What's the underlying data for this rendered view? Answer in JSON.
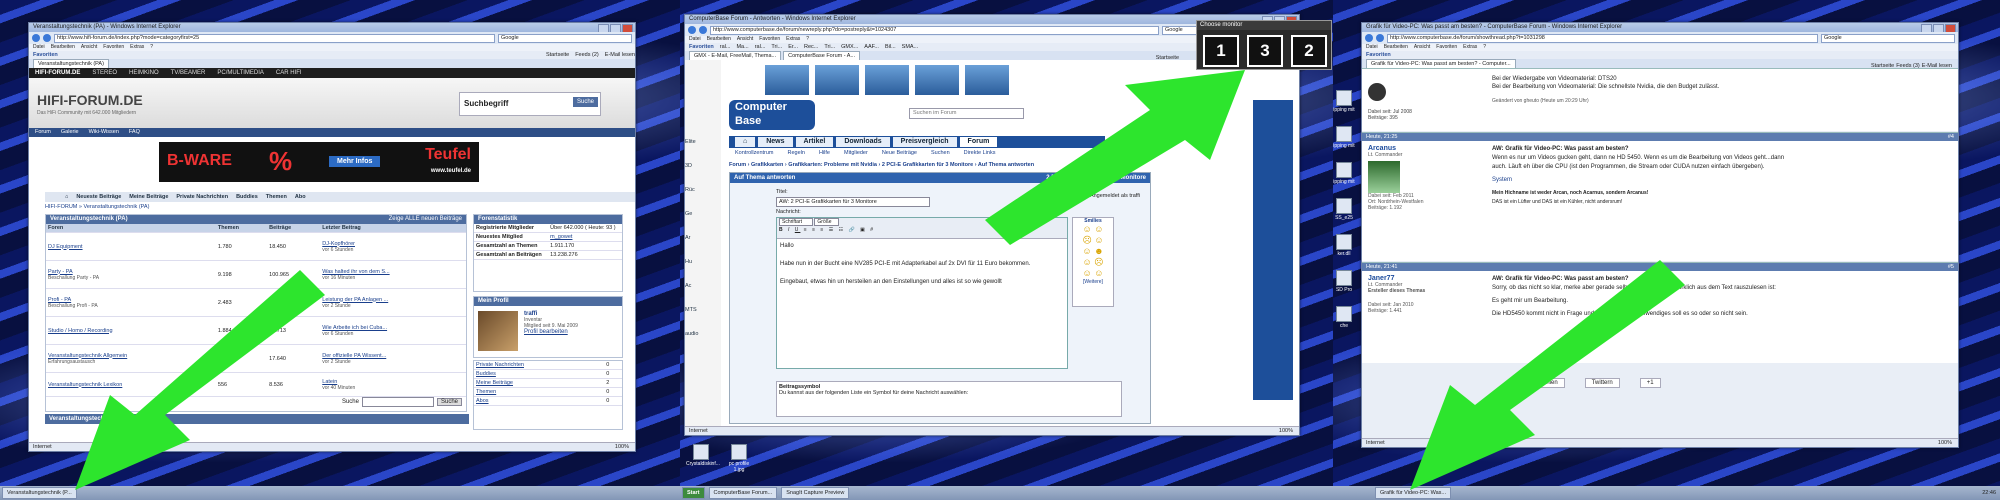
{
  "monitor1": {
    "window_title": "Veranstaltungstechnik (PA) - Windows Internet Explorer",
    "url": "http://www.hifi-forum.de/index.php?mode=categoryfirst=25",
    "search_engine": "Google",
    "menu": [
      "Datei",
      "Bearbeiten",
      "Ansicht",
      "Favoriten",
      "Extras",
      "?"
    ],
    "favorites_label": "Favoriten",
    "fav_items": [
      "Startseite",
      "Feeds (2)",
      "E-Mail lesen"
    ],
    "tab": "Veranstaltungstechnik (PA)",
    "site_top": [
      "HIFI-FORUM.DE",
      "STEREO",
      "HEIMKINO",
      "TV/BEAMER",
      "PC/MULTIMEDIA",
      "CAR HIFI"
    ],
    "logo": "HIFI-FORUM.DE",
    "logo_sub": "Das HiFi Community mit 642.000 Mitgliedern",
    "search_label": "Suchbegriff",
    "search_btn": "Suche",
    "nav_tabs": [
      "Forum",
      "Galerie",
      "Wiki-Wissen",
      "FAQ"
    ],
    "ad_left": "B-WARE",
    "ad_pct": "%",
    "ad_btn": "Mehr Infos",
    "ad_brand": "Teufel",
    "ad_url": "www.teufel.de",
    "menu_row": [
      "Neueste Beiträge",
      "Meine Beiträge",
      "Private Nachrichten",
      "Buddies",
      "Themen",
      "Abo"
    ],
    "breadcrumb": "HIFI-FORUM » Veranstaltungstechnik (PA)",
    "section_title": "Veranstaltungstechnik (PA)",
    "section_link": "Zeige ALLE neuen Beiträge",
    "table_headers": [
      "Foren",
      "Themen",
      "Beiträge",
      "Letzter Beitrag"
    ],
    "rows": [
      {
        "name": "DJ Equipment",
        "themen": "1.780",
        "beitraege": "18.450",
        "last": "DJ-Kopfhörer",
        "last_sub": "vor 6 Stunden"
      },
      {
        "name": "Party - PA",
        "sub": "Beschallung Party - PA",
        "themen": "9.198",
        "beitraege": "100.965",
        "last": "Was halted ihr von dem S...",
        "last_sub": "vor 16 Minuten"
      },
      {
        "name": "Profi - PA",
        "sub": "Beschallung Profi - PA",
        "themen": "2.483",
        "beitraege": "34.886",
        "last": "Leistung der PA Anlagen ...",
        "last_sub": "vor 2 Stunde"
      },
      {
        "name": "Studio / Homo / Recording",
        "themen": "1.884",
        "beitraege": "12.713",
        "last": "Wie Arbeite ich bei Cuba...",
        "last_sub": "vor 6 Stunden"
      },
      {
        "name": "Veranstaltungstechnik Allgemein",
        "sub": "Erfahrungsaustausch",
        "themen": "800",
        "beitraege": "17.640",
        "last": "Der offizielle PA Wissent...",
        "last_sub": "vor 2 Stunde"
      },
      {
        "name": "Veranstaltungstechnik Lexikon",
        "themen": "556",
        "beitraege": "8.536",
        "last": "Latein",
        "last_sub": "vor 40 Minuten"
      }
    ],
    "search_bottom": "Suche",
    "stats_title": "Forenstatistik",
    "stats": [
      {
        "label": "Registrierte Mitglieder",
        "value": "Über 642.000 ( Heute: 93 )"
      },
      {
        "label": "Neuestes Mitglied",
        "value": "m_gowet"
      },
      {
        "label": "Gesamtzahl an Themen",
        "value": "1.911.170"
      },
      {
        "label": "Gesamtzahl an Beiträgen",
        "value": "13.238.276"
      }
    ],
    "profile_title": "Mein Profil",
    "profile_name": "traffi",
    "profile_sub": "Inventar",
    "profile_since": "Mitglied seit 9. Mai 2009",
    "profile_edit": "Profil bearbeiten",
    "side_links": [
      {
        "label": "Private Nachrichten",
        "count": "0"
      },
      {
        "label": "Buddies",
        "count": "0"
      },
      {
        "label": "Meine Beiträge",
        "count": "2"
      },
      {
        "label": "Themen",
        "count": "0"
      },
      {
        "label": "Abos",
        "count": "0"
      }
    ],
    "bottom_section": "Veranstaltungstechnik",
    "status": "Internet",
    "zoom": "100%",
    "taskbar_item": "Veranstaltungstechnik (P..."
  },
  "monitor2": {
    "window_title": "ComputerBase Forum - Antworten - Windows Internet Explorer",
    "url": "http://www.computerbase.de/forum/newreply.php?do=postreply&t=1024307",
    "search_engine": "Google",
    "menu": [
      "Datei",
      "Bearbeiten",
      "Ansicht",
      "Favoriten",
      "Extras",
      "?"
    ],
    "favorites_label": "Favoriten",
    "fav_items": [
      "ral...",
      "Ma...",
      "ral...",
      "Tri...",
      "Er...",
      "Rec...",
      "Tri...",
      "GMX...",
      "AAF...",
      "Bil...",
      "SMA..."
    ],
    "tabs": [
      "GMX - E-Mail, FreeMail, Thema...",
      "ComputerBase Forum - A..."
    ],
    "fav_right": [
      "Startseite",
      "Feeds (3)"
    ],
    "logo_top": "Computer",
    "logo_bottom": "Base",
    "cb_search": "Suchen im Forum",
    "nav": [
      "News",
      "Artikel",
      "Downloads",
      "Preisvergleich",
      "Forum"
    ],
    "subnav": [
      "Kontrollzentrum",
      "Regeln",
      "Hilfe",
      "Mitglieder",
      "Neue Beiträge",
      "Suchen",
      "Direkte Links"
    ],
    "breadcrumb": "Forum › Grafikkarten › Grafikkarten: Probleme mit Nvidia › 2 PCI-E Grafikkarten für 3 Monitore › Auf Thema antworten",
    "reply_title": "Auf Thema antworten",
    "logged_in": "Angemeldet als traffi",
    "back_link": "2 PCI-E Grafikkarten für 3 Monitore",
    "title_label": "Titel:",
    "title_value": "AW: 2 PCI-E Grafikkarten für 3 Monitore",
    "message_label": "Nachricht:",
    "font_select": "Schriftart",
    "size_select": "Größe",
    "message_lines": [
      "Hallo",
      "Habe nun in der Bucht eine NV285 PCI-E mit Adapterkabel auf 2x DVI für 11 Euro bekommen.",
      "Eingebaut, etwas hin un hersteilen an den Einstellungen und alles ist so wie gewollt"
    ],
    "smilies_label": "Smilies",
    "more_label": "[Weitere]",
    "post_icon_label": "Beitragssymbol",
    "post_icon_text": "Du kannst aus der folgenden Liste ein Symbol für deine Nachricht auswählen:",
    "side_left": [
      "Elite",
      "3D",
      "Rüc",
      "Ge",
      "Ar",
      "Hu",
      "Ac",
      "MTS",
      "audio"
    ],
    "status": "Internet",
    "zoom": "100%",
    "chooser_title": "Choose monitor",
    "chooser_buttons": [
      "1",
      "3",
      "2"
    ],
    "desktop_icons": [
      "Crystaldiskinf...",
      "pc profile 1.jpg"
    ],
    "taskbar": [
      "Start",
      "ComputerBase Forum...",
      "SnagIt Capture Preview"
    ]
  },
  "monitor3": {
    "window_title": "Grafik für Video-PC: Was passt am besten? - ComputerBase Forum - Windows Internet Explorer",
    "url": "http://www.computerbase.de/forum/showthread.php?t=1031298",
    "search_engine": "Google",
    "menu": [
      "Datei",
      "Bearbeiten",
      "Ansicht",
      "Favoriten",
      "Extras",
      "?"
    ],
    "favorites_label": "Favoriten",
    "tab": "Grafik für Video-PC: Was passt am besten? - Computer...",
    "fav_right": [
      "Startseite",
      "Feeds (3)",
      "E-Mail lesen"
    ],
    "post0_lines": [
      "Bei der Wiedergabe von Videomaterial: DTS20",
      "Bei der Bearbeitung von Videomaterial: Die schnellste Nvidia, die den Budget zulässt."
    ],
    "post0_edit": "Geändert von gheuto (Heute um 20:29 Uhr)",
    "post0_meta": [
      "Dabei seit: Jul 2008",
      "Beiträge: 395"
    ],
    "posts": [
      {
        "time": "Heute, 21:25",
        "num": "#4",
        "user": "Arcanus",
        "rank": "Lt. Commander",
        "title": "AW: Grafik für Video-PC: Was passt am besten?",
        "lines": [
          "Wenn es nur um Videos gucken geht, dann ne HD 5450. Wenn es um die Bearbeitung von Videos geht...dann",
          "auch. Läuft eh über die CPU (ist den Programmen, die Stream oder CUDA nutzen einfach übergeben).",
          "System",
          "Mein Hichname ist weder Arcan, noch Acarnus, sondern Arcanus!",
          "DAS ist ein Lüfter und DAS ist ein Kühler, nicht andersrum!"
        ],
        "meta": [
          "Dabei seit: Feb 2011",
          "Ort: Nordrhein-Westfalen",
          "Beiträge: 1.192"
        ]
      },
      {
        "time": "Heute, 21:41",
        "num": "#5",
        "user": "Janer77",
        "rank": "Lt. Commander",
        "rank2": "Ersteller dieses Themas",
        "title": "AW: Grafik für Video-PC: Was passt am besten?",
        "lines": [
          "Sorry, ob das nicht so klar, merke aber gerade selber, dass das nicht wirklich aus dem Text rauszulesen ist:",
          "Es geht mir um Bearbeitung.",
          "Die HD5450 kommt nicht in Frage und was dermaßen aufwendiges soll es so oder so nicht sein."
        ],
        "meta": [
          "Dabei seit: Jan 2010",
          "Beiträge: 1.441"
        ]
      }
    ],
    "bottom_buttons": [
      "Empfehlen",
      "Twittern",
      "+1"
    ],
    "status": "Internet",
    "zoom": "100%",
    "taskbar_item": "Grafik für Video-PC: Was...",
    "clock": "22:46",
    "desktop_icons": [
      "ipping mit",
      "ipping mit",
      "ipping mit",
      "SS_e25",
      "ker.dll",
      "SD Pro",
      "che"
    ]
  },
  "colors": {
    "arrow": "#2de52d",
    "cb_blue": "#1d4f9a",
    "hifi_blue": "#2e4e86",
    "wallpaper": "#0b1450"
  }
}
